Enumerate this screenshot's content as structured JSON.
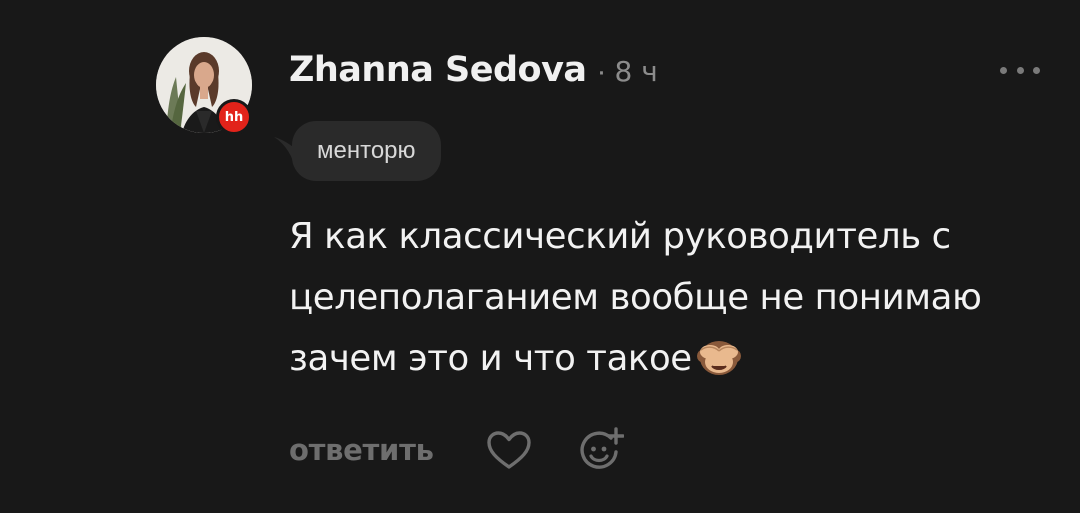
{
  "comment": {
    "author": "Zhanna Sedova",
    "separator": "·",
    "time": "8 ч",
    "badge": "hh",
    "tag": "менторю",
    "text": "Я как классический руководитель с целеполаганием вообще не понимаю зачем это и что такое",
    "emoji_name": "see-no-evil-monkey-icon"
  },
  "actions": {
    "reply_label": "ответить",
    "like_icon": "heart-icon",
    "react_icon": "add-reaction-icon",
    "more_icon": "more-horizontal-icon"
  },
  "colors": {
    "background": "#181818",
    "badge": "#e2231a",
    "muted": "#6e6e6e",
    "tag_bg": "#2a2a2a"
  }
}
